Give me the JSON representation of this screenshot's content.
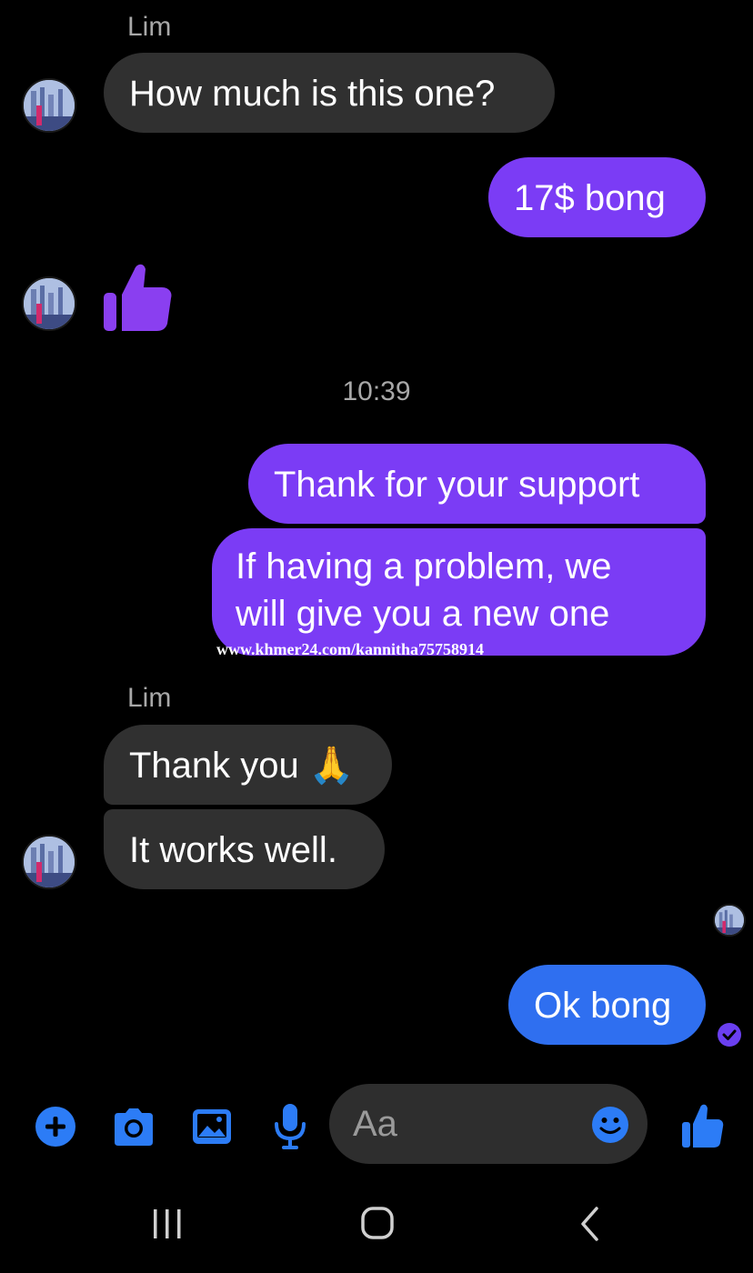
{
  "conversation": {
    "messages": [
      {
        "id": "m1",
        "direction": "in",
        "sender": "Lim",
        "text": "How much is this one?"
      },
      {
        "id": "m2",
        "direction": "out",
        "text": "17$ bong"
      },
      {
        "id": "m3",
        "direction": "in",
        "type": "like"
      },
      {
        "id": "m4",
        "direction": "out",
        "text": "Thank for your support"
      },
      {
        "id": "m5",
        "direction": "out",
        "text_line1": "If having a problem, we",
        "text_line2": "will give you a new one"
      },
      {
        "id": "m6",
        "direction": "in",
        "sender": "Lim",
        "text": "Thank you 🙏"
      },
      {
        "id": "m7",
        "direction": "in",
        "text": "It works well."
      },
      {
        "id": "m8",
        "direction": "out",
        "text": "Ok bong"
      }
    ],
    "timestamp": "10:39",
    "watermark": "www.khmer24.com/kannitha75758914"
  },
  "composer": {
    "placeholder": "Aa",
    "icons": [
      "plus-icon",
      "camera-icon",
      "image-icon",
      "mic-icon",
      "emoji-icon",
      "thumbs-up-icon"
    ]
  },
  "navbar": {
    "icons": [
      "recents-icon",
      "home-icon",
      "back-icon"
    ]
  },
  "colors": {
    "outgoing_bubble": "#7b3cf5",
    "outgoing_last_bubble": "#2f6ff0",
    "incoming_bubble": "#303030",
    "accent_blue": "#2c7cf6",
    "background": "#000000"
  }
}
